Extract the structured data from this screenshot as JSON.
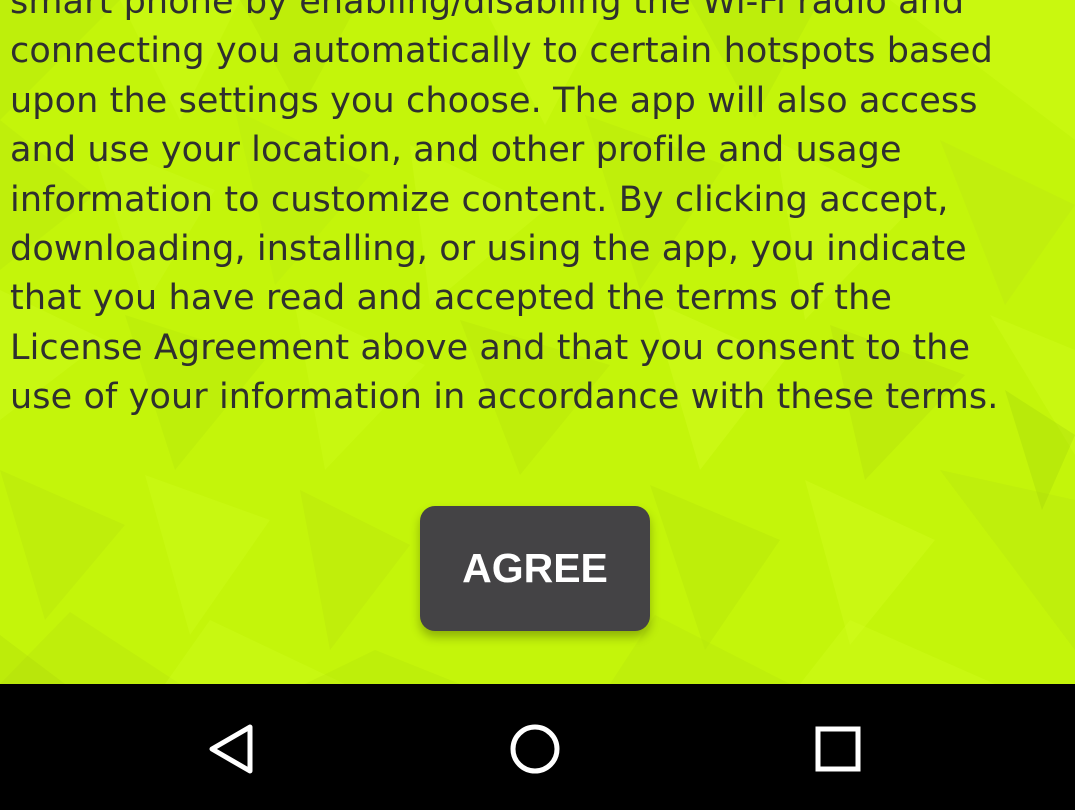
{
  "license": {
    "lines": [
      "smart phone by enabling/disabling the Wi-Fi radio and",
      "connecting you automatically to certain hotspots based",
      "upon the settings you choose. The app will also access",
      "and use your location, and other profile and usage",
      "information to customize content. By clicking accept,",
      "downloading, installing, or using the app, you indicate",
      "that you have read and accepted the terms of the",
      "License Agreement above and that you consent to the",
      "use of your information in accordance with these terms."
    ]
  },
  "agree_button": {
    "label": "AGREE"
  },
  "navigation": {
    "back_icon": "back-triangle-icon",
    "home_icon": "home-circle-icon",
    "recents_icon": "recents-square-icon"
  },
  "colors": {
    "background": "#c4f50a",
    "text": "#2f2f2f",
    "button": "#444345",
    "button_text": "#ffffff",
    "navigation_bar": "#000000",
    "navigation_icon": "#ffffff"
  }
}
